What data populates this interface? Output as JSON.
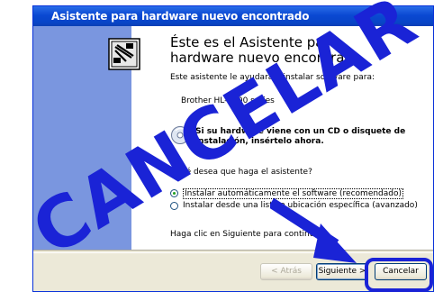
{
  "window": {
    "title": "Asistente para hardware nuevo encontrado"
  },
  "wizard": {
    "heading": "Éste es el Asistente para hardware nuevo encontrado",
    "intro": "Este asistente le ayudará a instalar software para:",
    "device": "Brother HL-1400 series",
    "cd_prompt_line1": "Si su hardware viene con un CD o disquete de",
    "cd_prompt_line2": "instalación, insértelo ahora.",
    "question": "¿Qué desea que haga el asistente?",
    "options": [
      {
        "label": "Instalar automáticamente el software (recomendado)",
        "selected": true
      },
      {
        "label": "Instalar desde una lista o ubicación específica (avanzado)",
        "selected": false
      }
    ],
    "continue_hint": "Haga clic en Siguiente para continuar."
  },
  "buttons": {
    "back": "< Atrás",
    "next": "Siguiente >",
    "cancel": "Cancelar"
  },
  "overlay": {
    "text": "CANCELAR",
    "color": "#1a23d6"
  },
  "colors": {
    "titlebar": "#0a48d2",
    "left_panel": "#7a96df",
    "dialog_bg": "#ece9d8"
  }
}
